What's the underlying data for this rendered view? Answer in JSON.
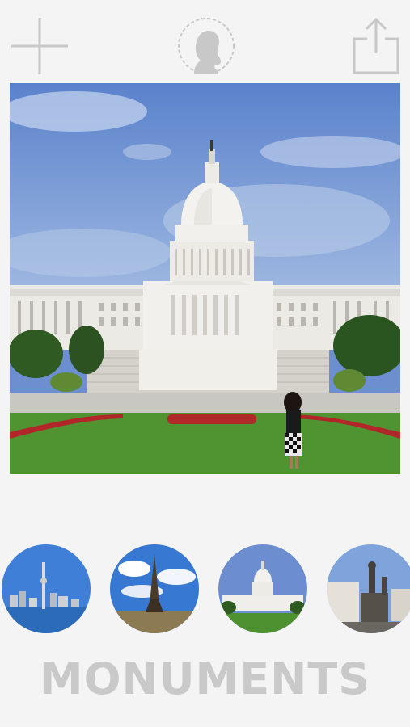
{
  "toolbar": {
    "add_icon": "plus-icon",
    "silhouette_icon": "person-silhouette-icon",
    "share_icon": "share-export-icon"
  },
  "photo": {
    "subject": "us-capitol-with-person"
  },
  "thumbnails": [
    {
      "icon": "toronto-skyline-thumbnail"
    },
    {
      "icon": "eiffel-tower-thumbnail"
    },
    {
      "icon": "us-capitol-thumbnail"
    },
    {
      "icon": "statue-monument-thumbnail"
    }
  ],
  "category_label": "MONUMENTS",
  "colors": {
    "background": "#f4f4f4",
    "icon_gray": "#c8c8c8",
    "label_gray": "#c9c9c9"
  }
}
